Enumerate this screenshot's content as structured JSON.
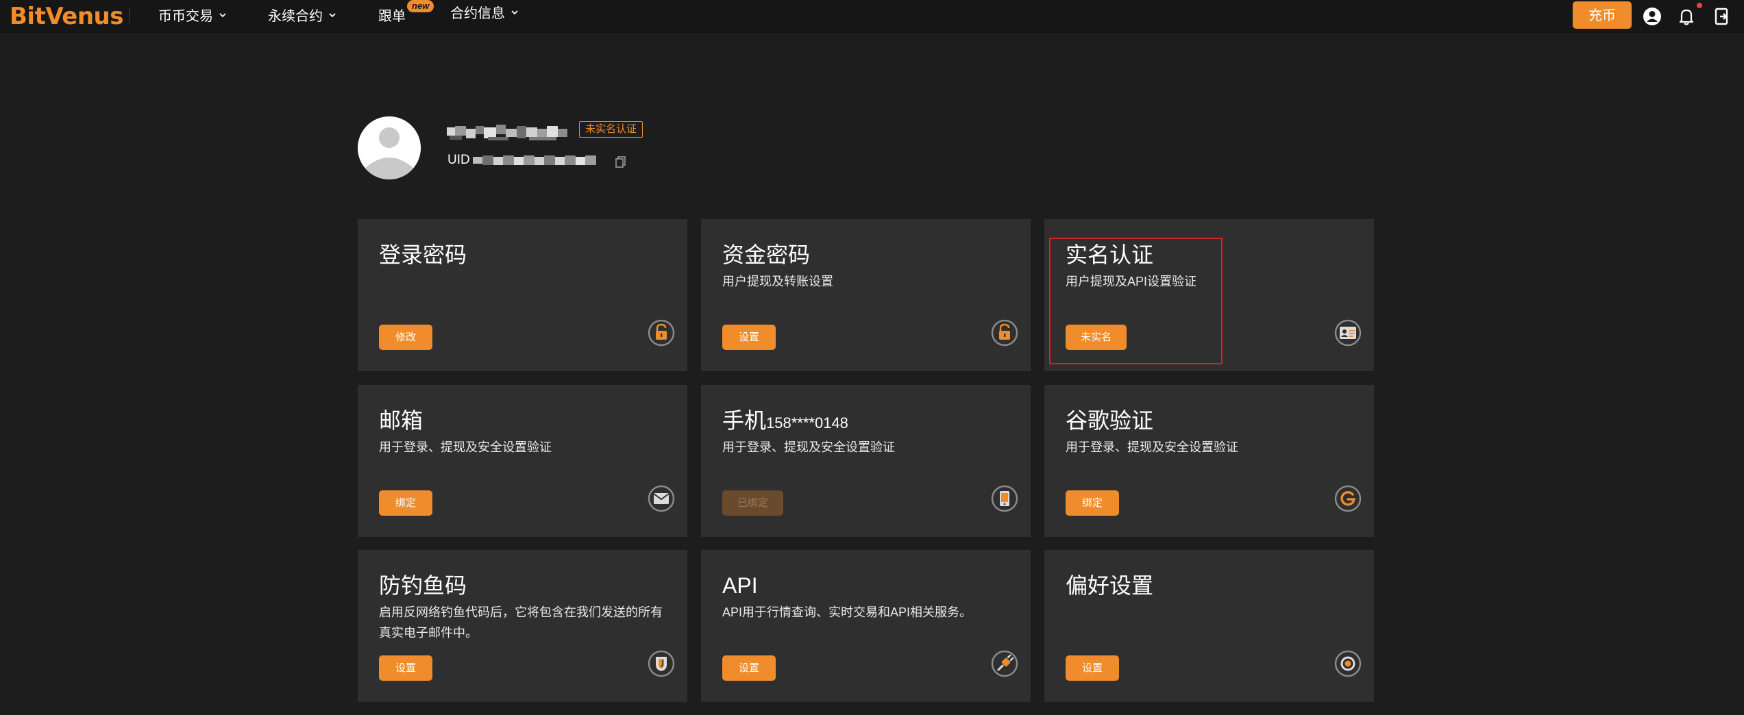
{
  "brand": {
    "logo_text": "BitVenus",
    "accent_color": "#f08c2b"
  },
  "nav": {
    "items": [
      {
        "label": "币币交易",
        "has_dropdown": true
      },
      {
        "label": "永续合约",
        "has_dropdown": true
      },
      {
        "label": "跟单",
        "has_dropdown": false,
        "badge": "new"
      },
      {
        "label": "合约信息",
        "has_dropdown": true
      }
    ],
    "deposit_label": "充币",
    "icons": [
      "user-icon",
      "bell-icon",
      "download-app-icon"
    ]
  },
  "profile": {
    "kyc_status": "未实名认证",
    "uid_label": "UID"
  },
  "cards": [
    {
      "title": "登录密码",
      "desc": "",
      "button": "修改",
      "icon": "lock-icon",
      "button_enabled": true
    },
    {
      "title": "资金密码",
      "desc": "用户提现及转账设置",
      "button": "设置",
      "icon": "lock-icon",
      "button_enabled": true
    },
    {
      "title": "实名认证",
      "desc": "用户提现及API设置验证",
      "button": "未实名",
      "icon": "id-card-icon",
      "button_enabled": true
    },
    {
      "title": "邮箱",
      "desc": "用于登录、提现及安全设置验证",
      "button": "绑定",
      "icon": "mail-icon",
      "button_enabled": true
    },
    {
      "title": "手机",
      "title_suffix": "158****0148",
      "desc": "用于登录、提现及安全设置验证",
      "button": "已绑定",
      "icon": "phone-icon",
      "button_enabled": false
    },
    {
      "title": "谷歌验证",
      "desc": "用于登录、提现及安全设置验证",
      "button": "绑定",
      "icon": "google-icon",
      "button_enabled": true
    },
    {
      "title": "防钓鱼码",
      "desc": "启用反网络钓鱼代码后，它将包含在我们发送的所有真实电子邮件中。",
      "button": "设置",
      "icon": "shield-icon",
      "button_enabled": true
    },
    {
      "title": "API",
      "desc": "API用于行情查询、实时交易和API相关服务。",
      "button": "设置",
      "icon": "api-icon",
      "button_enabled": true
    },
    {
      "title": "偏好设置",
      "desc": "",
      "button": "设置",
      "icon": "preferences-icon",
      "button_enabled": true
    }
  ]
}
